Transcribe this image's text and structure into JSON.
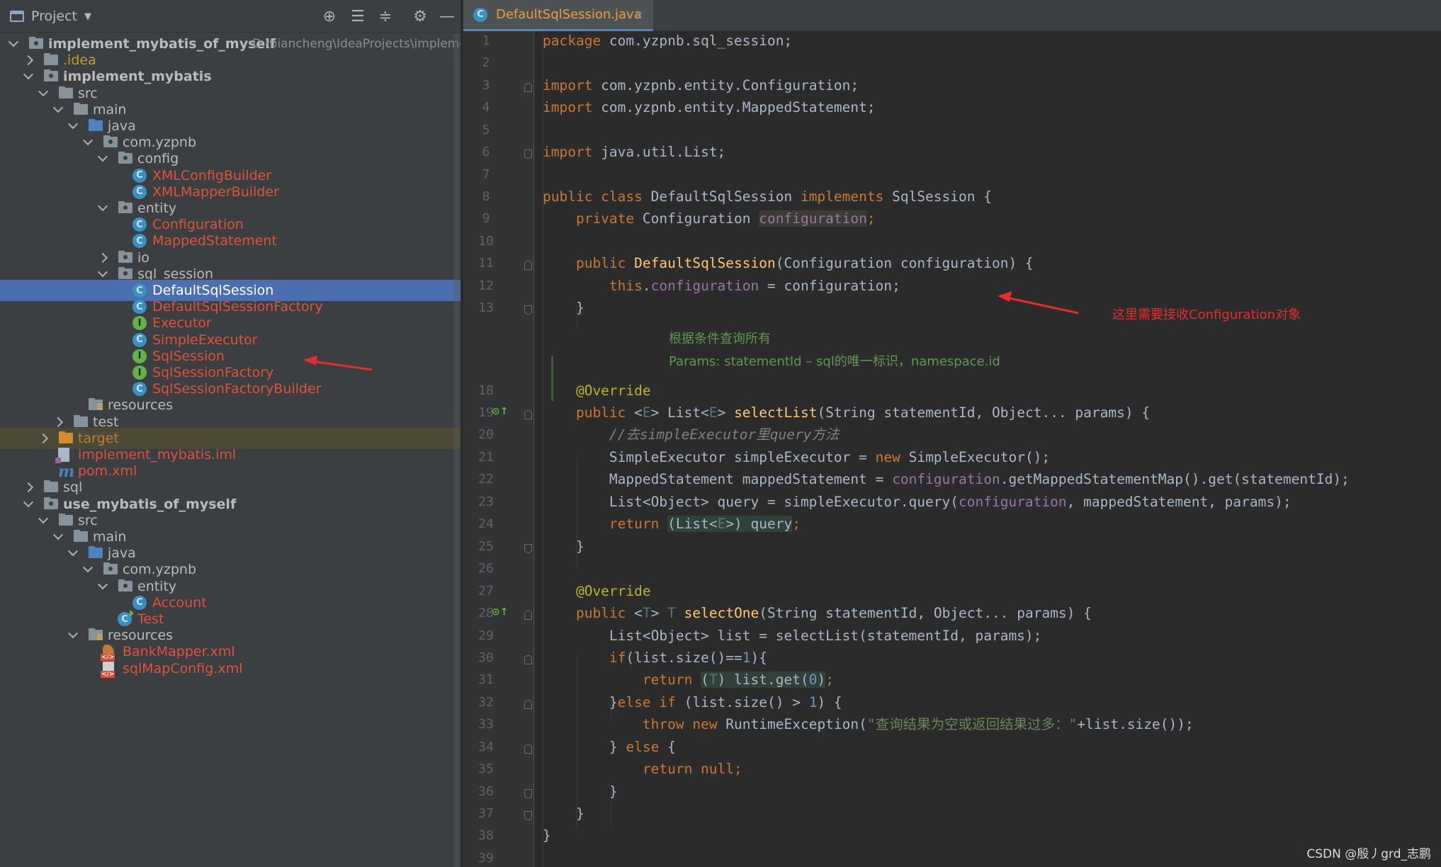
{
  "project_panel": {
    "title": "Project",
    "tools": [
      "locate-icon",
      "expand-all-icon",
      "collapse-all-icon",
      "gear-icon",
      "minimize-icon"
    ],
    "tree": [
      {
        "label": "implement_mybatis_of_myself",
        "path": "D:\\biancheng\\IdeaProjects\\impleme",
        "icon": "module-folder-icon",
        "expanded": true,
        "bold": true
      },
      {
        "label": ".idea",
        "icon": "folder-icon",
        "expanded": false,
        "color": "gold"
      },
      {
        "label": "implement_mybatis",
        "icon": "module-folder-icon",
        "expanded": true,
        "bold": true
      },
      {
        "label": "src",
        "icon": "folder-icon",
        "expanded": true
      },
      {
        "label": "main",
        "icon": "folder-icon",
        "expanded": true
      },
      {
        "label": "java",
        "icon": "source-folder-icon",
        "expanded": true
      },
      {
        "label": "com.yzpnb",
        "icon": "package-icon",
        "expanded": true
      },
      {
        "label": "config",
        "icon": "package-icon",
        "expanded": true
      },
      {
        "label": "XMLConfigBuilder",
        "icon": "class-icon",
        "color": "red"
      },
      {
        "label": "XMLMapperBuilder",
        "icon": "class-icon",
        "color": "red"
      },
      {
        "label": "entity",
        "icon": "package-icon",
        "expanded": true
      },
      {
        "label": "Configuration",
        "icon": "class-icon",
        "color": "red"
      },
      {
        "label": "MappedStatement",
        "icon": "class-icon",
        "color": "red"
      },
      {
        "label": "io",
        "icon": "package-icon",
        "expanded": false
      },
      {
        "label": "sql_session",
        "icon": "package-icon",
        "expanded": true
      },
      {
        "label": "DefaultSqlSession",
        "icon": "class-icon",
        "color": "red",
        "selected": true
      },
      {
        "label": "DefaultSqlSessionFactory",
        "icon": "class-icon",
        "color": "red"
      },
      {
        "label": "Executor",
        "icon": "interface-icon",
        "color": "red"
      },
      {
        "label": "SimpleExecutor",
        "icon": "class-icon",
        "color": "red"
      },
      {
        "label": "SqlSession",
        "icon": "interface-icon",
        "color": "red"
      },
      {
        "label": "SqlSessionFactory",
        "icon": "interface-icon",
        "color": "red"
      },
      {
        "label": "SqlSessionFactoryBuilder",
        "icon": "class-icon",
        "color": "red"
      },
      {
        "label": "resources",
        "icon": "resources-folder-icon"
      },
      {
        "label": "test",
        "icon": "folder-icon",
        "expanded": false
      },
      {
        "label": "target",
        "icon": "excluded-folder-icon",
        "expanded": false,
        "color": "orange",
        "highlighted": true
      },
      {
        "label": "implement_mybatis.iml",
        "icon": "iml-file-icon",
        "color": "red"
      },
      {
        "label": "pom.xml",
        "icon": "maven-icon",
        "color": "red"
      },
      {
        "label": "sql",
        "icon": "folder-icon",
        "expanded": false
      },
      {
        "label": "use_mybatis_of_myself",
        "icon": "module-folder-icon",
        "expanded": true,
        "bold": true
      },
      {
        "label": "src",
        "icon": "folder-icon",
        "expanded": true
      },
      {
        "label": "main",
        "icon": "folder-icon",
        "expanded": true
      },
      {
        "label": "java",
        "icon": "source-folder-icon",
        "expanded": true
      },
      {
        "label": "com.yzpnb",
        "icon": "package-icon",
        "expanded": true
      },
      {
        "label": "entity",
        "icon": "package-icon",
        "expanded": true
      },
      {
        "label": "Account",
        "icon": "class-icon",
        "color": "red"
      },
      {
        "label": "Test",
        "icon": "runnable-class-icon",
        "color": "red"
      },
      {
        "label": "resources",
        "icon": "resources-folder-icon",
        "expanded": true
      },
      {
        "label": "BankMapper.xml",
        "icon": "mybatis-xml-icon",
        "color": "red"
      },
      {
        "label": "sqlMapConfig.xml",
        "icon": "xml-file-icon",
        "color": "red"
      }
    ]
  },
  "editor": {
    "tab": {
      "label": "DefaultSqlSession.java",
      "icon": "class-icon"
    },
    "line_numbers": [
      "1",
      "2",
      "3",
      "4",
      "5",
      "6",
      "7",
      "8",
      "9",
      "10",
      "11",
      "12",
      "13",
      "18",
      "19",
      "20",
      "21",
      "22",
      "23",
      "24",
      "25",
      "26",
      "27",
      "28",
      "29",
      "30",
      "31",
      "32",
      "33",
      "34",
      "35",
      "36",
      "37",
      "38",
      "39"
    ],
    "doc_comment": {
      "line1": "根据条件查询所有",
      "line2": "Params: statementId – sql的唯一标识，namespace.id"
    },
    "code": {
      "l1_pkg": "package",
      "l1_rest": " com.yzpnb.sql_session;",
      "l3_kw": "import",
      "l3_rest": " com.yzpnb.entity.Configuration;",
      "l4_kw": "import",
      "l4_rest": " com.yzpnb.entity.MappedStatement;",
      "l6_kw": "import",
      "l6_rest": " java.util.List;",
      "l8_kw1": "public class",
      "l8_name": " DefaultSqlSession ",
      "l8_kw2": "implements",
      "l8_rest": " SqlSession {",
      "l9_kw": "    private",
      "l9_type": " Configuration ",
      "l9_field": "configuration",
      "l9_end": ";",
      "l11_kw": "    public",
      "l11_fn": " DefaultSqlSession",
      "l11_rest": "(Configuration configuration) {",
      "l12_kw": "        this",
      "l12_dot": ".",
      "l12_field": "configuration",
      "l12_rest": " = configuration;",
      "l13": "    }",
      "l18_ann": "    @Override",
      "l19_kw": "    public",
      "l19_a": " <",
      "l19_tp": "E",
      "l19_b": "> List<",
      "l19_tp2": "E",
      "l19_c": "> ",
      "l19_fn": "selectList",
      "l19_rest": "(String statementId, Object... params) {",
      "l20_cmt": "        //去simpleExecutor里query方法",
      "l21_a": "        SimpleExecutor simpleExecutor = ",
      "l21_kw": "new",
      "l21_b": " SimpleExecutor();",
      "l22_a": "        MappedStatement mappedStatement = ",
      "l22_field": "configuration",
      "l22_b": ".getMappedStatementMap().get(statementId);",
      "l23_a": "        List<Object> query = simpleExecutor.query(",
      "l23_field": "configuration",
      "l23_b": ", mappedStatement, params);",
      "l24_kw": "        return ",
      "l24_a": "(List<",
      "l24_tp": "E",
      "l24_b": ">) query",
      "l24_end": ";",
      "l25": "    }",
      "l27_ann": "    @Override",
      "l28_kw": "    public",
      "l28_a": " <",
      "l28_tp": "T",
      "l28_b": "> ",
      "l28_tp2": "T",
      "l28_c": " ",
      "l28_fn": "selectOne",
      "l28_rest": "(String statementId, Object... params) {",
      "l29": "        List<Object> list = selectList(statementId, params);",
      "l30_kw": "        if",
      "l30_a": "(list.size()==",
      "l30_num": "1",
      "l30_b": "){",
      "l31_kw": "            return ",
      "l31_a": "(",
      "l31_tp": "T",
      "l31_b": ") list.get(",
      "l31_num": "0",
      "l31_c": ")",
      "l31_end": ";",
      "l32_a": "        }",
      "l32_kw": "else if",
      "l32_b": " (list.size() > ",
      "l32_num": "1",
      "l32_c": ") {",
      "l33_kw1": "            throw",
      "l33_kw2": " new",
      "l33_a": " RuntimeException(",
      "l33_str": "\"查询结果为空或返回结果过多：\"",
      "l33_b": "+list.size());",
      "l34_a": "        } ",
      "l34_kw": "else",
      "l34_b": " {",
      "l35_kw": "            return null",
      "l35_b": ";",
      "l36": "        }",
      "l37": "    }",
      "l38": "}"
    }
  },
  "annotation_note": "这里需要接收Configuration对象",
  "watermark": "CSDN @殷丿grd_志鹏",
  "colors": {
    "keyword": "#cc7832",
    "method": "#ffc66d",
    "field": "#9876aa",
    "selection": "#4b6eaf",
    "annotation_arrow": "#e02f2f"
  }
}
